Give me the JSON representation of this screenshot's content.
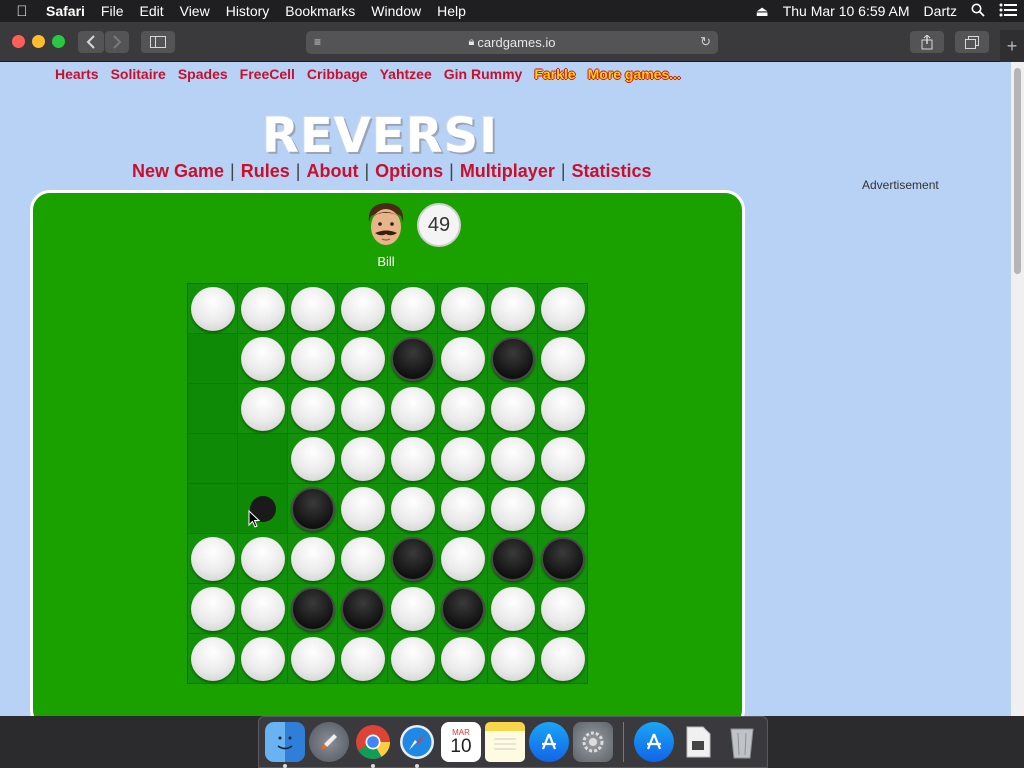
{
  "menubar": {
    "app": "Safari",
    "items": [
      "File",
      "Edit",
      "View",
      "History",
      "Bookmarks",
      "Window",
      "Help"
    ],
    "datetime": "Thu Mar 10  6:59 AM",
    "user": "Dartz"
  },
  "browser": {
    "url": "cardgames.io"
  },
  "game_links": [
    {
      "label": "Hearts"
    },
    {
      "label": "Solitaire"
    },
    {
      "label": "Spades"
    },
    {
      "label": "FreeCell"
    },
    {
      "label": "Cribbage"
    },
    {
      "label": "Yahtzee"
    },
    {
      "label": "Gin Rummy"
    },
    {
      "label": "Farkle"
    },
    {
      "label": "More games..."
    }
  ],
  "logo": "REVERSI",
  "nav": {
    "new_game": "New Game",
    "rules": "Rules",
    "about": "About",
    "options": "Options",
    "multiplayer": "Multiplayer",
    "statistics": "Statistics",
    "sep": "|"
  },
  "advertisement": "Advertisement",
  "opponent": {
    "name": "Bill",
    "score": "49"
  },
  "board": [
    [
      "W",
      "W",
      "W",
      "W",
      "W",
      "W",
      "W",
      "W"
    ],
    [
      "E",
      "W",
      "W",
      "W",
      "B",
      "W",
      "B",
      "W"
    ],
    [
      "E",
      "W",
      "W",
      "W",
      "W",
      "W",
      "W",
      "W"
    ],
    [
      "E",
      "E",
      "W",
      "W",
      "W",
      "W",
      "W",
      "W"
    ],
    [
      "E",
      "H",
      "B",
      "W",
      "W",
      "W",
      "W",
      "W"
    ],
    [
      "W",
      "W",
      "W",
      "W",
      "B",
      "W",
      "B",
      "B"
    ],
    [
      "W",
      "W",
      "B",
      "B",
      "W",
      "B",
      "W",
      "W"
    ],
    [
      "W",
      "W",
      "W",
      "W",
      "W",
      "W",
      "W",
      "W"
    ]
  ],
  "dock": [
    "finder-icon",
    "launchpad-icon",
    "chrome-icon",
    "safari-icon",
    "calendar-icon",
    "notes-icon",
    "app-store-icon",
    "system-preferences-icon",
    "app-store-icon-2",
    "file-icon",
    "trash-icon"
  ],
  "calendar": {
    "month": "MAR",
    "day": "10"
  }
}
